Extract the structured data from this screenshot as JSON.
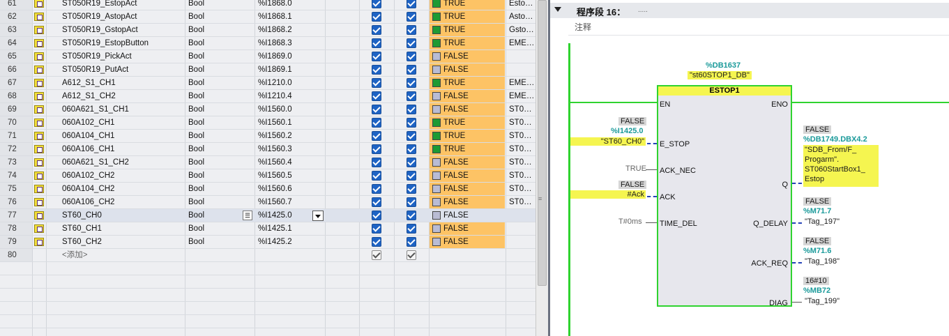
{
  "table": {
    "rows": [
      {
        "num": "61",
        "name": "ST050R19_EstopAct",
        "type": "Bool",
        "address": "%I1868.0",
        "monitor": "TRUE",
        "comment": "Esto…",
        "state": "true",
        "bg": "orange"
      },
      {
        "num": "62",
        "name": "ST050R19_AstopAct",
        "type": "Bool",
        "address": "%I1868.1",
        "monitor": "TRUE",
        "comment": "Asto…",
        "state": "true",
        "bg": "orange"
      },
      {
        "num": "63",
        "name": "ST050R19_GstopAct",
        "type": "Bool",
        "address": "%I1868.2",
        "monitor": "TRUE",
        "comment": "Gsto…",
        "state": "true",
        "bg": "orange"
      },
      {
        "num": "64",
        "name": "ST050R19_EstopButton",
        "type": "Bool",
        "address": "%I1868.3",
        "monitor": "TRUE",
        "comment": "EME…",
        "state": "true",
        "bg": "orange"
      },
      {
        "num": "65",
        "name": "ST050R19_PickAct",
        "type": "Bool",
        "address": "%I1869.0",
        "monitor": "FALSE",
        "comment": "",
        "state": "false",
        "bg": "orange"
      },
      {
        "num": "66",
        "name": "ST050R19_PutAct",
        "type": "Bool",
        "address": "%I1869.1",
        "monitor": "FALSE",
        "comment": "",
        "state": "false",
        "bg": "orange"
      },
      {
        "num": "67",
        "name": "A612_S1_CH1",
        "type": "Bool",
        "address": "%I1210.0",
        "monitor": "TRUE",
        "comment": "EME…",
        "state": "true",
        "bg": "orange"
      },
      {
        "num": "68",
        "name": "A612_S1_CH2",
        "type": "Bool",
        "address": "%I1210.4",
        "monitor": "FALSE",
        "comment": "EME…",
        "state": "false",
        "bg": "orange"
      },
      {
        "num": "69",
        "name": "060A621_S1_CH1",
        "type": "Bool",
        "address": "%I1560.0",
        "monitor": "FALSE",
        "comment": "ST0…",
        "state": "false",
        "bg": "orange"
      },
      {
        "num": "70",
        "name": "060A102_CH1",
        "type": "Bool",
        "address": "%I1560.1",
        "monitor": "TRUE",
        "comment": "ST0…",
        "state": "true",
        "bg": "orange"
      },
      {
        "num": "71",
        "name": "060A104_CH1",
        "type": "Bool",
        "address": "%I1560.2",
        "monitor": "TRUE",
        "comment": "ST0…",
        "state": "true",
        "bg": "orange"
      },
      {
        "num": "72",
        "name": "060A106_CH1",
        "type": "Bool",
        "address": "%I1560.3",
        "monitor": "TRUE",
        "comment": "ST0…",
        "state": "true",
        "bg": "orange"
      },
      {
        "num": "73",
        "name": "060A621_S1_CH2",
        "type": "Bool",
        "address": "%I1560.4",
        "monitor": "FALSE",
        "comment": "ST0…",
        "state": "false",
        "bg": "orange"
      },
      {
        "num": "74",
        "name": "060A102_CH2",
        "type": "Bool",
        "address": "%I1560.5",
        "monitor": "FALSE",
        "comment": "ST0…",
        "state": "false",
        "bg": "orange"
      },
      {
        "num": "75",
        "name": "060A104_CH2",
        "type": "Bool",
        "address": "%I1560.6",
        "monitor": "FALSE",
        "comment": "ST0…",
        "state": "false",
        "bg": "orange"
      },
      {
        "num": "76",
        "name": "060A106_CH2",
        "type": "Bool",
        "address": "%I1560.7",
        "monitor": "FALSE",
        "comment": "ST0…",
        "state": "false",
        "bg": "orange"
      },
      {
        "num": "77",
        "name": "ST60_CH0",
        "type": "Bool",
        "address": "%I1425.0",
        "monitor": "FALSE",
        "comment": "",
        "state": "false",
        "bg": "none"
      },
      {
        "num": "78",
        "name": "ST60_CH1",
        "type": "Bool",
        "address": "%I1425.1",
        "monitor": "FALSE",
        "comment": "",
        "state": "false",
        "bg": "orange"
      },
      {
        "num": "79",
        "name": "ST60_CH2",
        "type": "Bool",
        "address": "%I1425.2",
        "monitor": "FALSE",
        "comment": "",
        "state": "false",
        "bg": "orange"
      }
    ],
    "add_row": {
      "num": "80",
      "label": "<添加>"
    }
  },
  "network": {
    "title": "程序段 16：",
    "title_extra": ".....",
    "comment": "注释",
    "db_address": "%DB1637",
    "db_name": "\"st60STOP1_DB\"",
    "block_name": "ESTOP1",
    "pins_in": {
      "en": "EN",
      "estop": "E_STOP",
      "ack_nec": "ACK_NEC",
      "ack": "ACK",
      "time_del": "TIME_DEL"
    },
    "pins_out": {
      "eno": "ENO",
      "q": "Q",
      "q_delay": "Q_DELAY",
      "ack_req": "ACK_REQ",
      "diag": "DIAG"
    },
    "estop_value": "FALSE",
    "estop_address": "%I1425.0",
    "estop_tag": "\"ST60_CH0\"",
    "ack_nec_value": "TRUE",
    "ack_value": "FALSE",
    "ack_tag": "#Ack",
    "time_del_value": "T#0ms",
    "q_value": "FALSE",
    "q_address": "%DB1749.DBX4.2",
    "q_tag_lines": [
      "\"SDB_From/F_",
      "Progarm\".",
      "ST060StartBox1_",
      "Estop"
    ],
    "q_delay_value": "FALSE",
    "q_delay_address": "%M71.7",
    "q_delay_tag": "\"Tag_197\"",
    "ack_req_value": "FALSE",
    "ack_req_address": "%M71.6",
    "ack_req_tag": "\"Tag_198\"",
    "diag_value": "16#10",
    "diag_address": "%MB72",
    "diag_tag": "\"Tag_199\""
  },
  "colors": {
    "monitor_bg": "#fdc365",
    "true_indicator": "#1e9a33",
    "false_indicator": "#b9bcd4",
    "rail": "#2fd32f",
    "highlight": "#f5f550",
    "address": "#1a9a9a"
  }
}
